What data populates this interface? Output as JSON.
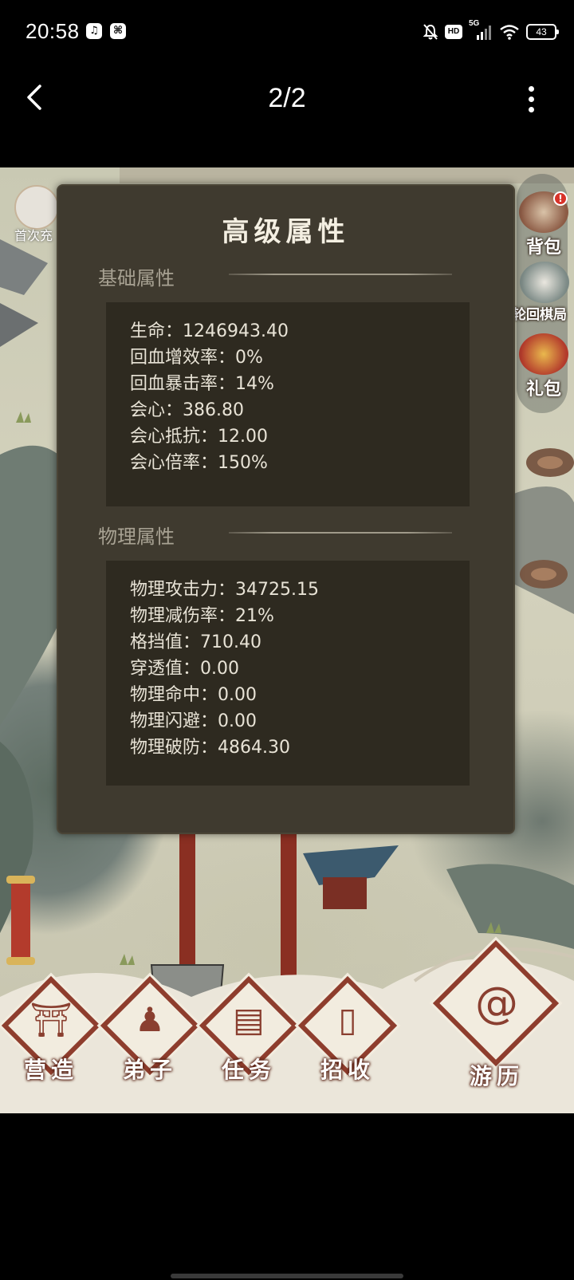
{
  "status_bar": {
    "time": "20:58",
    "network": "5G",
    "hd": "HD",
    "battery": "43"
  },
  "viewer": {
    "page_counter": "2/2"
  },
  "game": {
    "first_recharge_label": "首次充",
    "side_buttons": [
      {
        "label": "背包",
        "icon": "bag-icon"
      },
      {
        "label": "轮回棋局",
        "icon": "chess-board-icon"
      },
      {
        "label": "礼包",
        "icon": "gift-icon"
      }
    ],
    "panel": {
      "title": "高级属性",
      "sections": [
        {
          "heading": "基础属性",
          "stats": [
            "生命：1246943.40",
            "回血增效率：0%",
            "回血暴击率：14%",
            "会心：386.80",
            "会心抵抗：12.00",
            "会心倍率：150%"
          ]
        },
        {
          "heading": "物理属性",
          "stats": [
            "物理攻击力：34725.15",
            "物理减伤率：21%",
            "格挡值：710.40",
            "穿透值：0.00",
            "物理命中：0.00",
            "物理闪避：0.00",
            "物理破防：4864.30"
          ]
        }
      ]
    },
    "bottom_nav": [
      {
        "label": "营造",
        "icon": "building-icon"
      },
      {
        "label": "弟子",
        "icon": "disciple-icon"
      },
      {
        "label": "任务",
        "icon": "scroll-icon"
      },
      {
        "label": "招收",
        "icon": "recruit-card-icon"
      },
      {
        "label": "游历",
        "icon": "travel-icon"
      }
    ]
  }
}
